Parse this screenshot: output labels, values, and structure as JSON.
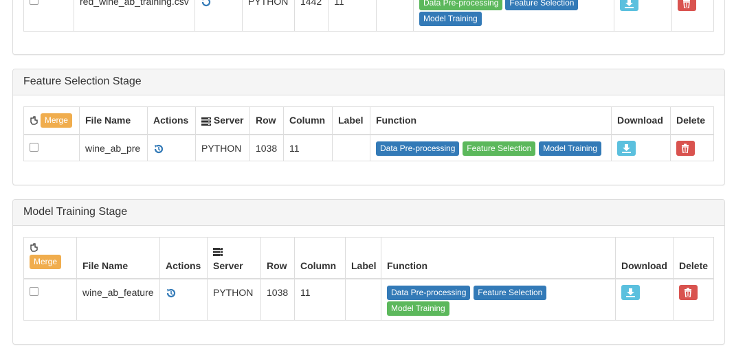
{
  "top_panel": {
    "row": {
      "file_name": "red_wine_ab_training.csv",
      "server": "PYTHON",
      "row": "1442",
      "column": "11",
      "label": "",
      "functions": [
        "Data Pre-processing",
        "Feature Selection",
        "Model Training"
      ]
    }
  },
  "feature_panel": {
    "title": "Feature Selection Stage",
    "headers": {
      "merge": "Merge",
      "file_name": "File Name",
      "actions": "Actions",
      "server": "Server",
      "row": "Row",
      "column": "Column",
      "label": "Label",
      "function": "Function",
      "download": "Download",
      "delete": "Delete"
    },
    "row": {
      "file_name": "wine_ab_pre",
      "server": "PYTHON",
      "row": "1038",
      "column": "11",
      "label": "",
      "functions": [
        "Data Pre-processing",
        "Feature Selection",
        "Model Training"
      ]
    }
  },
  "model_panel": {
    "title": "Model Training Stage",
    "headers": {
      "merge": "Merge",
      "file_name": "File Name",
      "actions": "Actions",
      "server": "Server",
      "row": "Row",
      "column": "Column",
      "label": "Label",
      "function": "Function",
      "download": "Download",
      "delete": "Delete"
    },
    "row": {
      "file_name": "wine_ab_feature",
      "server": "PYTHON",
      "row": "1038",
      "column": "11",
      "label": "",
      "functions": [
        "Data Pre-processing",
        "Feature Selection",
        "Model Training"
      ]
    }
  },
  "colors": {
    "badge_blue": "#337ab7",
    "badge_green": "#5cb85c",
    "merge_orange": "#f0ad4e",
    "download_cyan": "#5bc0de",
    "delete_red": "#d9534f",
    "action_icon_blue": "#337ab7"
  },
  "icons": {
    "merge_header": "hand-pointer-icon",
    "server_header": "server-icon",
    "action": "history-icon",
    "download": "download-icon",
    "delete": "trash-icon"
  }
}
